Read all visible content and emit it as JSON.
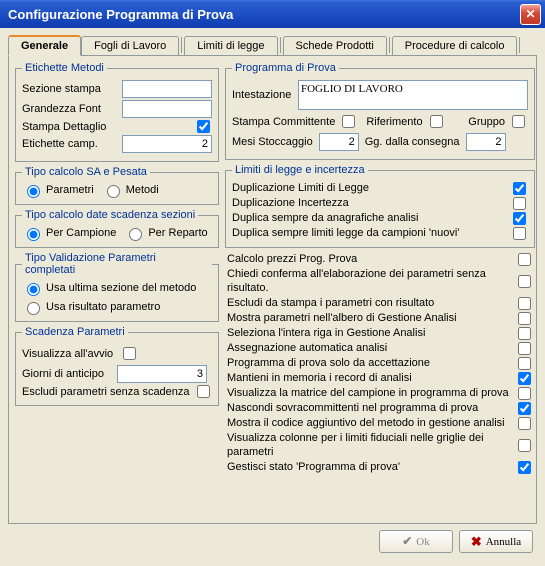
{
  "window": {
    "title": "Configurazione Programma di Prova"
  },
  "tabs": {
    "generale": "Generale",
    "fogli": "Fogli di Lavoro",
    "limiti": "Limiti di legge",
    "schede": "Schede Prodotti",
    "procedure": "Procedure di calcolo"
  },
  "left": {
    "etichette_metodi": {
      "legend": "Etichette Metodi",
      "sezione_stampa": "Sezione stampa",
      "grandezza_font": "Grandezza Font",
      "stampa_dettaglio": "Stampa Dettaglio",
      "etichette_camp": "Etichette camp.",
      "etichette_camp_val": "2"
    },
    "tipo_calcolo_sa": {
      "legend": "Tipo calcolo SA e Pesata",
      "parametri": "Parametri",
      "metodi": "Metodi"
    },
    "tipo_calcolo_date": {
      "legend": "Tipo calcolo date scadenza sezioni",
      "per_campione": "Per Campione",
      "per_reparto": "Per Reparto"
    },
    "tipo_validazione": {
      "legend": "Tipo Validazione Parametri completati",
      "usa_ultima": "Usa ultima sezione del metodo",
      "usa_risultato": "Usa risultato parametro"
    },
    "scadenza": {
      "legend": "Scadenza Parametri",
      "visualizza_avvio": "Visualizza all'avvio",
      "giorni_anticipo": "Giorni di anticipo",
      "giorni_anticipo_val": "3",
      "escludi": "Escludi parametri senza scadenza"
    }
  },
  "right": {
    "programma": {
      "legend": "Programma di Prova",
      "intestazione_lbl": "Intestazione",
      "intestazione_val": "FOGLIO DI LAVORO",
      "stampa_committente": "Stampa Committente",
      "riferimento": "Riferimento",
      "gruppo": "Gruppo",
      "mesi_stoccaggio": "Mesi Stoccaggio",
      "mesi_stoccaggio_val": "2",
      "gg_consegna": "Gg. dalla consegna",
      "gg_consegna_val": "2"
    },
    "limiti": {
      "legend": "Limiti di legge e incertezza",
      "o1": "Duplicazione Limiti di Legge",
      "o2": "Duplicazione Incertezza",
      "o3": "Duplica sempre da anagrafiche analisi",
      "o4": "Duplica sempre limiti legge da campioni 'nuovi'"
    },
    "opts": {
      "c1": "Calcolo prezzi Prog. Prova",
      "c2": "Chiedi conferma all'elaborazione dei parametri senza risultato.",
      "c3": "Escludi da stampa i parametri con risultato",
      "c4": "Mostra parametri nell'albero di Gestione Analisi",
      "c5": "Seleziona l'intera riga in Gestione Analisi",
      "c6": "Assegnazione automatica analisi",
      "c7": "Programma di prova solo da accettazione",
      "c8": "Mantieni in memoria i record di analisi",
      "c9": "Visualizza la matrice del campione in programma di prova",
      "c10": "Nascondi sovracommittenti nel programma di prova",
      "c11": "Mostra il codice aggiuntivo del metodo in gestione analisi",
      "c12": "Visualizza colonne per i limiti fiduciali nelle griglie dei parametri",
      "c13": "Gestisci stato 'Programma di prova'"
    }
  },
  "footer": {
    "ok": "Ok",
    "annulla": "Annulla"
  }
}
